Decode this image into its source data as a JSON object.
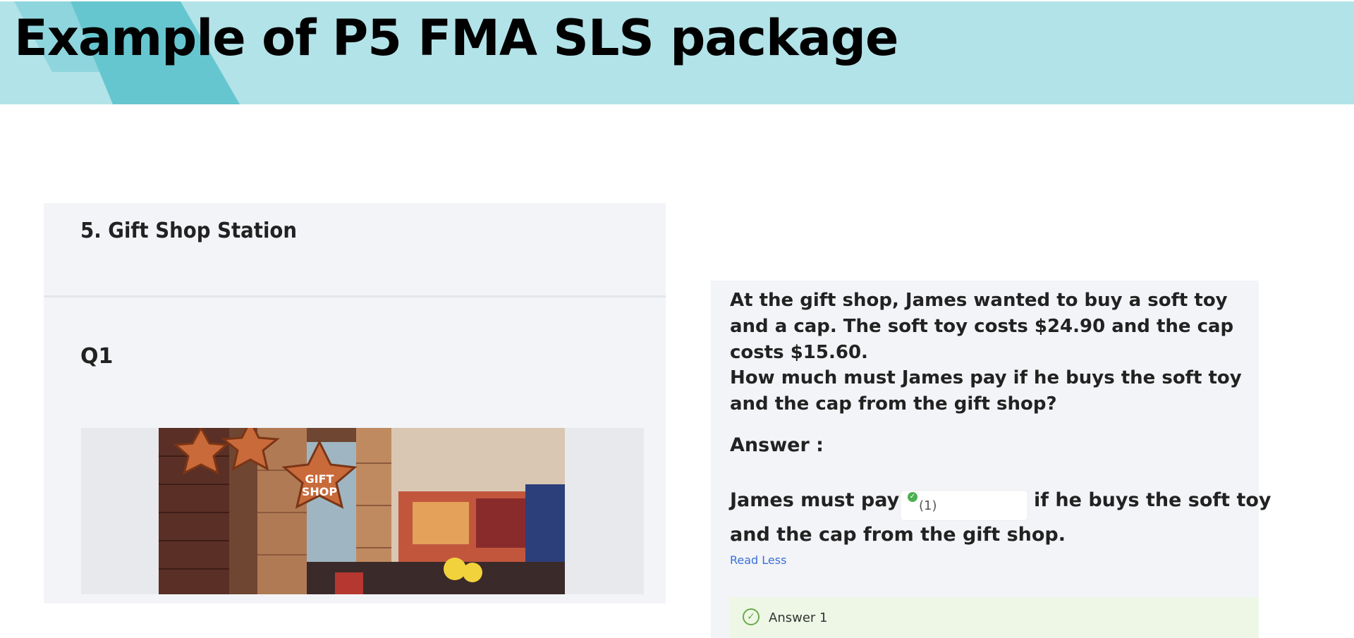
{
  "slide": {
    "title": "Example of P5 FMA SLS package"
  },
  "station": {
    "title": "5. Gift Shop Station",
    "question_label": "Q1",
    "image": {
      "sign_text_line1": "GIFT",
      "sign_text_line2": "SHOP"
    }
  },
  "question": {
    "paragraph1": "At the gift shop, James wanted to buy a soft toy and a cap. The soft toy costs $24.90 and the cap costs $15.60.",
    "paragraph2": "How much must James pay if he buys the soft toy and the cap from the gift shop?",
    "answer_heading": "Answer :",
    "answer_prefix": "James must pay $",
    "blank_label": "(1)",
    "answer_suffix": "if he buys the soft toy",
    "answer_line2": "and the cap from the gift shop.",
    "read_less": "Read Less",
    "answer_box_label": "Answer 1"
  },
  "colors": {
    "banner_light": "#b2e3e8",
    "banner_dark": "#66c6d0",
    "panel_bg": "#f3f4f7",
    "link": "#3a6fd8",
    "correct_green": "#4caf50",
    "answer_box_bg": "#eef7e6"
  },
  "icons": {
    "blank_status": "check-circle-filled-icon",
    "answer_status": "check-circle-outline-icon"
  }
}
